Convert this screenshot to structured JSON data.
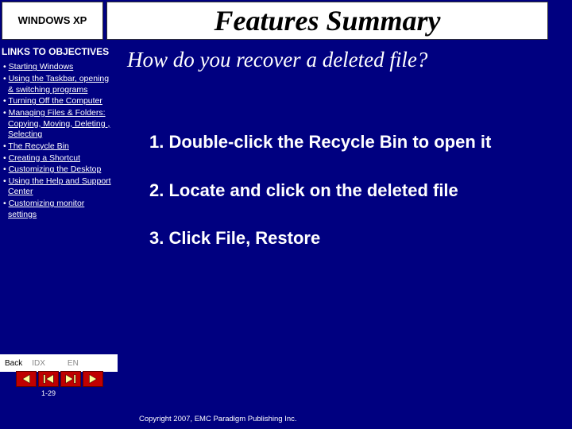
{
  "header": {
    "product": "WINDOWS XP",
    "title": "Features Summary"
  },
  "sidebar": {
    "title": "LINKS TO OBJECTIVES",
    "items": [
      "Starting Windows",
      "Using the Taskbar, opening & switching programs",
      "Turning Off the Computer",
      "Managing Files & Folders: Copying, Moving, Deleting , Selecting",
      "The Recycle Bin",
      "Creating a Shortcut",
      "Customizing the Desktop",
      "Using the Help and Support Center",
      "Customizing monitor settings"
    ]
  },
  "main": {
    "question": "How do you recover a deleted file?",
    "steps": [
      "Double-click the Recycle Bin to open it",
      "Locate and click on the deleted file",
      "Click File, Restore"
    ]
  },
  "nav": {
    "back": "Back",
    "idx": "IDX",
    "en": "EN"
  },
  "page_number": "1-29",
  "copyright": "Copyright 2007, EMC Paradigm Publishing Inc."
}
